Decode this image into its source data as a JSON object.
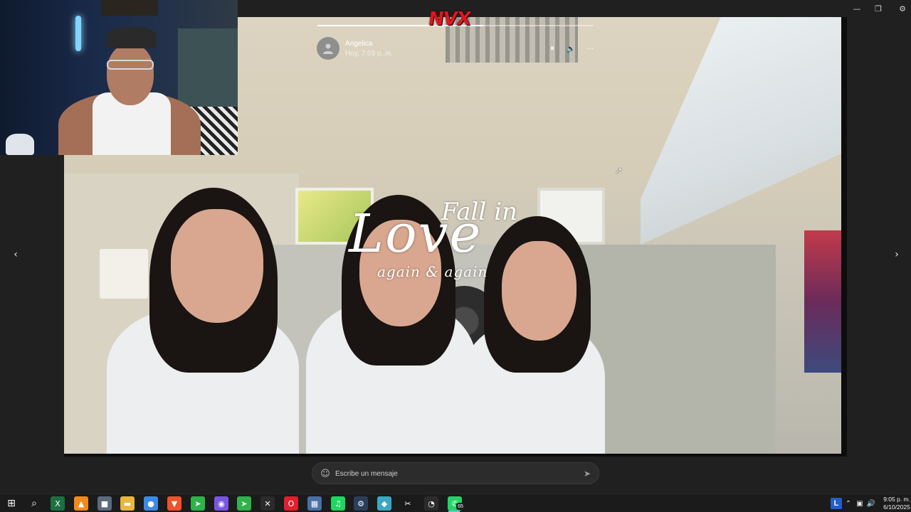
{
  "window": {
    "controls": {
      "minimize_glyph": "—",
      "restore_glyph": "❐",
      "settings_glyph": "⚙"
    }
  },
  "story": {
    "progress_fraction": 0.6,
    "logo_text": "NVX",
    "contact_name": "Angelica",
    "post_time": "Hoy, 7:03 p. m.",
    "avatar_icon": "person-icon",
    "pause_glyph": "⏸",
    "volume_glyph": "🔈",
    "more_glyph": "···",
    "overlay": {
      "fall_in": "Fall in",
      "love": "Love",
      "again": "again & again"
    }
  },
  "navigation": {
    "prev_glyph": "‹",
    "next_glyph": "›"
  },
  "reply": {
    "placeholder": "Escribe un mensaje",
    "emoji_glyph": "☺",
    "send_glyph": "➤"
  },
  "taskbar": {
    "start_glyph": "⊞",
    "search_glyph": "⌕",
    "apps": [
      {
        "name": "excel",
        "glyph": "X",
        "color": "#1d6f42"
      },
      {
        "name": "vlc",
        "glyph": "▲",
        "color": "#f08a1d"
      },
      {
        "name": "notes",
        "glyph": "■",
        "color": "#5a6b7d"
      },
      {
        "name": "file-explorer",
        "glyph": "▬",
        "color": "#e9b73c"
      },
      {
        "name": "chrome",
        "glyph": "●",
        "color": "#3d8ae5"
      },
      {
        "name": "brave",
        "glyph": "▼",
        "color": "#f0522b"
      },
      {
        "name": "app-green",
        "glyph": "➤",
        "color": "#2fb24a"
      },
      {
        "name": "messenger",
        "glyph": "◉",
        "color": "#7a56e0"
      },
      {
        "name": "app-green-2",
        "glyph": "➤",
        "color": "#2fb24a"
      },
      {
        "name": "capcut",
        "glyph": "✕",
        "color": "#2b2b2b"
      },
      {
        "name": "opera",
        "glyph": "O",
        "color": "#e0202e"
      },
      {
        "name": "calculator",
        "glyph": "▦",
        "color": "#4a6fa5"
      },
      {
        "name": "spotify",
        "glyph": "♫",
        "color": "#1ed760"
      },
      {
        "name": "steam",
        "glyph": "⚙",
        "color": "#2a3f5a"
      },
      {
        "name": "app-teal",
        "glyph": "◆",
        "color": "#3aa8c1"
      },
      {
        "name": "capcut-2",
        "glyph": "✂",
        "color": "#1a1a1a"
      },
      {
        "name": "app-clock",
        "glyph": "◔",
        "color": "#2b2b2b"
      },
      {
        "name": "whatsapp",
        "glyph": "✆",
        "color": "#25d366"
      }
    ],
    "whatsapp_badge": "65",
    "tray": {
      "lang": "L",
      "chevron": "⌃",
      "network": "▣",
      "volume": "🔊",
      "time": "9:05 p. m.",
      "date": "6/10/2025"
    }
  },
  "cursor_glyph": "➚"
}
